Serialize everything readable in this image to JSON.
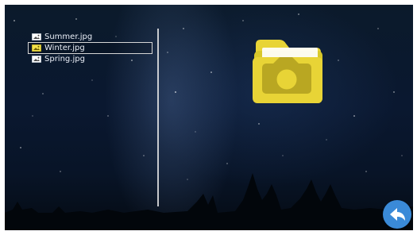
{
  "files": [
    {
      "name": "Summer.jpg",
      "icon": "image-file-icon",
      "selected": false
    },
    {
      "name": "Winter.jpg",
      "icon": "image-file-icon",
      "selected": true
    },
    {
      "name": "Spring.jpg",
      "icon": "image-file-icon",
      "selected": false
    }
  ],
  "preview": {
    "icon": "folder-camera-icon",
    "color": "#e8d436"
  },
  "back_button": {
    "icon": "back-arrow-icon",
    "color": "#3a8ad8"
  }
}
